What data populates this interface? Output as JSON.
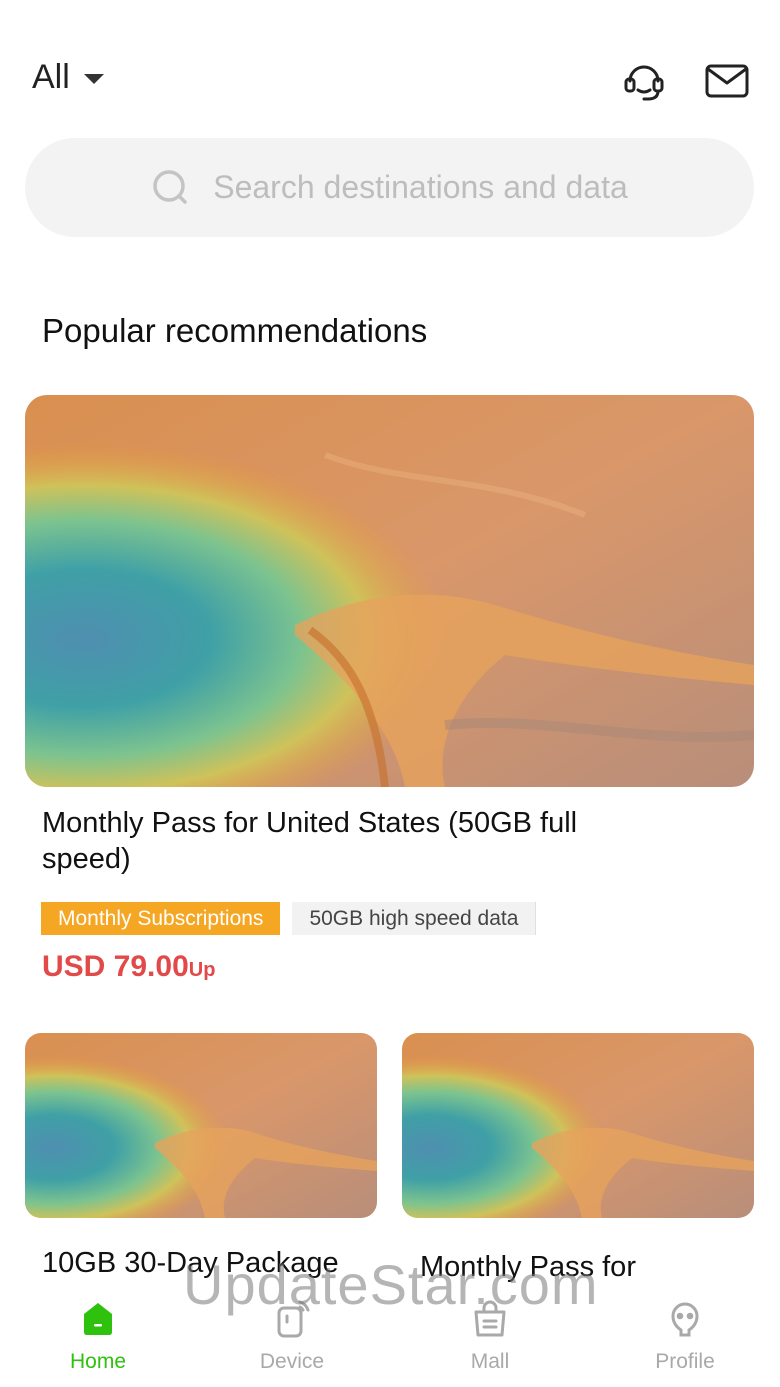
{
  "header": {
    "region_label": "All",
    "support_icon": "headset-icon",
    "mail_icon": "mail-icon"
  },
  "search": {
    "placeholder": "Search destinations and data",
    "icon": "search-icon"
  },
  "section": {
    "title": "Popular recommendations"
  },
  "featured": {
    "title": "Monthly Pass for United States (50GB full speed)",
    "tags": [
      "Monthly Subscriptions",
      "50GB high speed data"
    ],
    "price": "USD 79.00",
    "price_suffix": "Up"
  },
  "cards": [
    {
      "title": "10GB 30-Day Package"
    },
    {
      "title": "Monthly Pass for"
    }
  ],
  "tabbar": {
    "items": [
      {
        "label": "Home",
        "icon": "home-icon",
        "active": true
      },
      {
        "label": "Device",
        "icon": "device-icon",
        "active": false
      },
      {
        "label": "Mall",
        "icon": "shopping-bag-icon",
        "active": false
      },
      {
        "label": "Profile",
        "icon": "profile-icon",
        "active": false
      }
    ]
  },
  "watermark": "UpdateStar.com",
  "colors": {
    "accent_green": "#2ec20f",
    "price_red": "#e24a4a",
    "tag_orange": "#f5a623"
  }
}
